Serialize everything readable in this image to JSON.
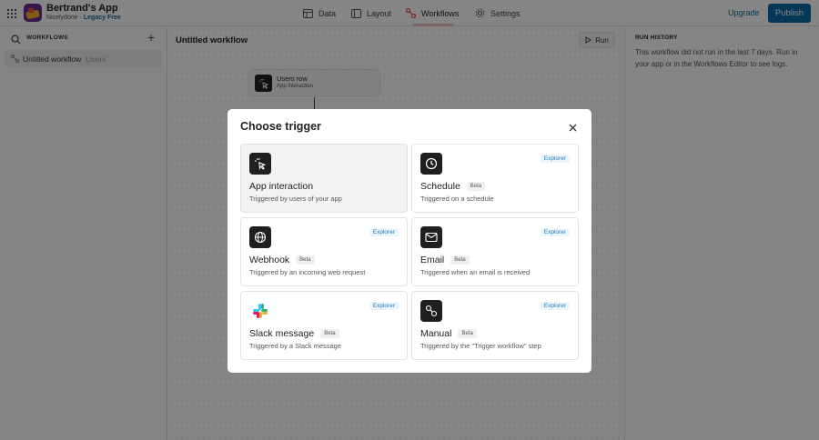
{
  "app": {
    "name": "Bertrand's App",
    "org": "Nicelydone",
    "separator": "·",
    "plan": "Legacy Free"
  },
  "nav": {
    "data": "Data",
    "layout": "Layout",
    "workflows": "Workflows",
    "settings": "Settings",
    "active": "Workflows"
  },
  "header": {
    "upgrade": "Upgrade",
    "publish": "Publish"
  },
  "sidebar": {
    "title": "WORKFLOWS",
    "items": [
      {
        "label": "Untitled workflow",
        "tag": "Users"
      }
    ]
  },
  "canvas": {
    "title": "Untitled workflow",
    "run_label": "Run",
    "node": {
      "title": "Users row",
      "subtitle": "App interaction"
    }
  },
  "run_history": {
    "title": "RUN HISTORY",
    "text": "This workflow did not run in the last 7 days. Run in your app or in the Workflows Editor to see logs."
  },
  "modal": {
    "title": "Choose trigger",
    "badge_beta": "Beta",
    "badge_explorer": "Explorer",
    "triggers": [
      {
        "name": "App interaction",
        "desc": "Triggered by users of your app",
        "selected": true,
        "icon": "cursor-click-icon"
      },
      {
        "name": "Schedule",
        "desc": "Triggered on a schedule",
        "beta": true,
        "explorer": true,
        "icon": "clock-icon"
      },
      {
        "name": "Webhook",
        "desc": "Triggered by an incoming web request",
        "beta": true,
        "explorer": true,
        "icon": "globe-icon"
      },
      {
        "name": "Email",
        "desc": "Triggered when an email is received",
        "beta": true,
        "explorer": true,
        "icon": "mail-icon"
      },
      {
        "name": "Slack message",
        "desc": "Triggered by a Slack message",
        "beta": true,
        "explorer": true,
        "icon": "slack-icon"
      },
      {
        "name": "Manual",
        "desc": "Triggered by the \"Trigger workflow\" step",
        "beta": true,
        "explorer": true,
        "icon": "workflow-icon"
      }
    ]
  },
  "colors": {
    "accent": "#0b6aa8",
    "explorer": "#1f7fb7",
    "overlay": "rgba(0,0,0,0.48)"
  }
}
